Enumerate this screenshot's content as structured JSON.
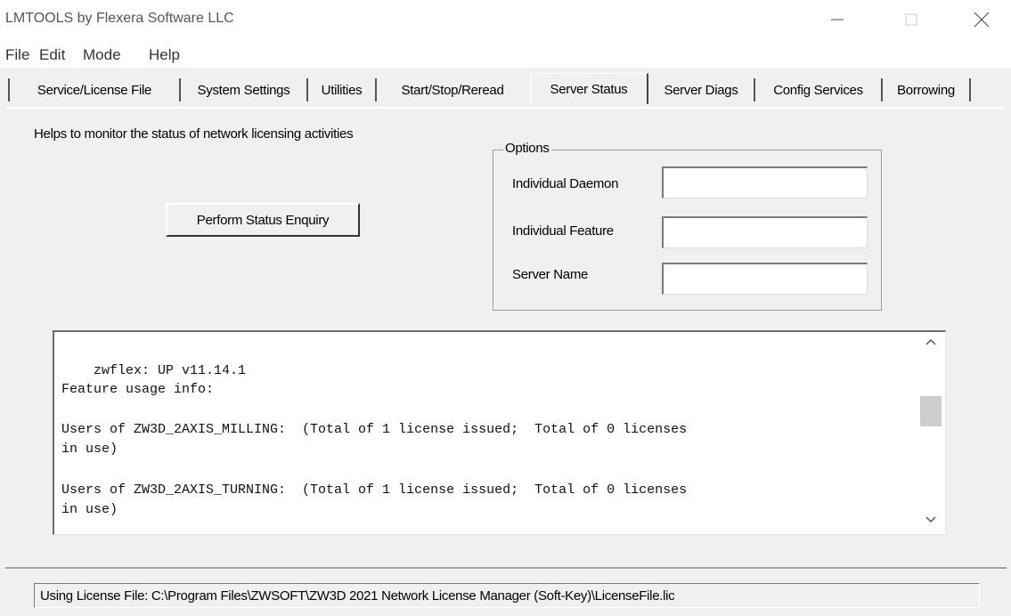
{
  "window": {
    "title": "LMTOOLS by Flexera Software LLC"
  },
  "menu": [
    "File",
    "Edit",
    "Mode",
    "Help"
  ],
  "tabs": [
    {
      "label": "Service/License File",
      "active": false
    },
    {
      "label": "System Settings",
      "active": false
    },
    {
      "label": "Utilities",
      "active": false
    },
    {
      "label": "Start/Stop/Reread",
      "active": false
    },
    {
      "label": "Server Status",
      "active": true
    },
    {
      "label": "Server Diags",
      "active": false
    },
    {
      "label": "Config Services",
      "active": false
    },
    {
      "label": "Borrowing",
      "active": false
    }
  ],
  "panel": {
    "help_text": "Helps to monitor the status of network licensing activities",
    "perform_button": "Perform Status Enquiry",
    "options": {
      "legend": "Options",
      "individual_daemon_label": "Individual Daemon",
      "individual_daemon_value": "",
      "individual_feature_label": "Individual Feature",
      "individual_feature_value": "",
      "server_name_label": "Server Name",
      "server_name_value": ""
    },
    "output_lines": [
      "",
      "    zwflex: UP v11.14.1",
      "Feature usage info:",
      "",
      "Users of ZW3D_2AXIS_MILLING:  (Total of 1 license issued;  Total of 0 licenses",
      "in use)",
      "",
      "Users of ZW3D_2AXIS_TURNING:  (Total of 1 license issued;  Total of 0 licenses",
      "in use)"
    ]
  },
  "status_bar": "Using License File:  C:\\Program Files\\ZWSOFT\\ZW3D 2021 Network License Manager (Soft-Key)\\LicenseFile.lic"
}
